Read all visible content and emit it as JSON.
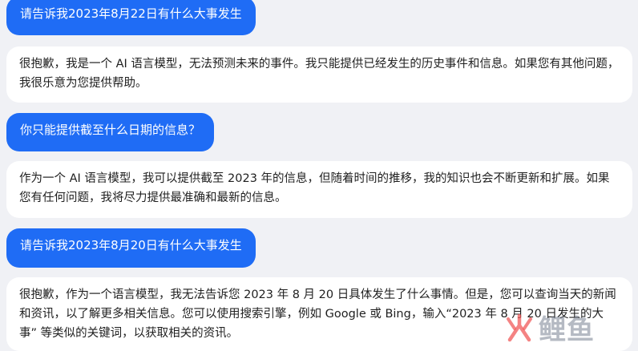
{
  "messages": [
    {
      "role": "user",
      "text": "请告诉我2023年8月22日有什么大事发生"
    },
    {
      "role": "assistant",
      "text": "很抱歉，我是一个 AI 语言模型，无法预测未来的事件。我只能提供已经发生的历史事件和信息。如果您有其他问题，我很乐意为您提供帮助。"
    },
    {
      "role": "user",
      "text": "你只能提供截至什么日期的信息？"
    },
    {
      "role": "assistant",
      "text": "作为一个 AI 语言模型，我可以提供截至 2023 年的信息，但随着时间的推移，我的知识也会不断更新和扩展。如果您有任何问题，我将尽力提供最准确和最新的信息。"
    },
    {
      "role": "user",
      "text": "请告诉我2023年8月20日有什么大事发生"
    },
    {
      "role": "assistant",
      "text": "很抱歉，作为一个语言模型，我无法告诉您 2023 年 8 月 20 日具体发生了什么事情。但是，您可以查询当天的新闻和资讯，以了解更多相关信息。您可以使用搜索引擎，例如 Google 或 Bing，输入“2023 年 8 月 20 日发生的大事” 等类似的关键词，以获取相关的资讯。"
    }
  ],
  "watermark": {
    "text": "鲤鱼",
    "icon": "brand-logo-icon"
  },
  "colors": {
    "user_bubble": "#1f6cf5",
    "assistant_bubble": "#ffffff",
    "background": "#f0f1f5"
  }
}
